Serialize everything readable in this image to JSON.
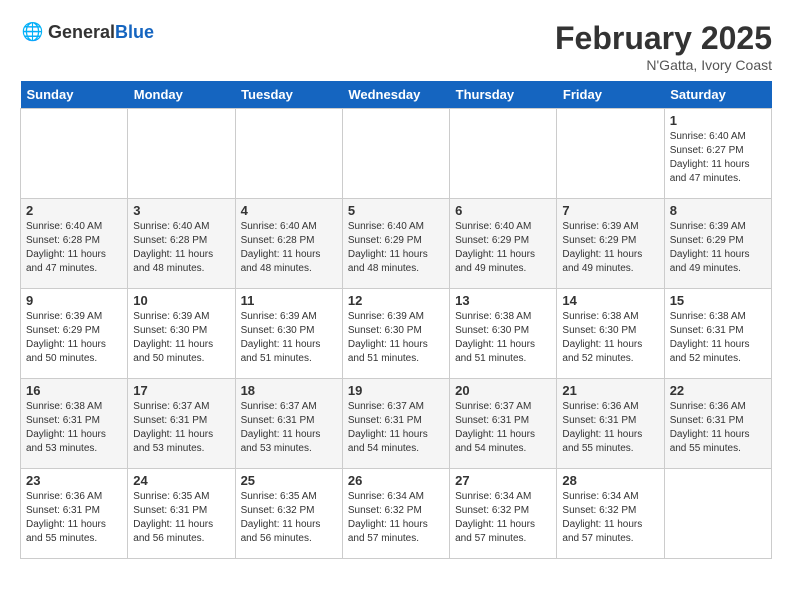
{
  "logo": {
    "text_general": "General",
    "text_blue": "Blue"
  },
  "title": "February 2025",
  "subtitle": "N'Gatta, Ivory Coast",
  "days_of_week": [
    "Sunday",
    "Monday",
    "Tuesday",
    "Wednesday",
    "Thursday",
    "Friday",
    "Saturday"
  ],
  "weeks": [
    [
      {
        "day": "",
        "info": ""
      },
      {
        "day": "",
        "info": ""
      },
      {
        "day": "",
        "info": ""
      },
      {
        "day": "",
        "info": ""
      },
      {
        "day": "",
        "info": ""
      },
      {
        "day": "",
        "info": ""
      },
      {
        "day": "1",
        "info": "Sunrise: 6:40 AM\nSunset: 6:27 PM\nDaylight: 11 hours and 47 minutes."
      }
    ],
    [
      {
        "day": "2",
        "info": "Sunrise: 6:40 AM\nSunset: 6:28 PM\nDaylight: 11 hours and 47 minutes."
      },
      {
        "day": "3",
        "info": "Sunrise: 6:40 AM\nSunset: 6:28 PM\nDaylight: 11 hours and 48 minutes."
      },
      {
        "day": "4",
        "info": "Sunrise: 6:40 AM\nSunset: 6:28 PM\nDaylight: 11 hours and 48 minutes."
      },
      {
        "day": "5",
        "info": "Sunrise: 6:40 AM\nSunset: 6:29 PM\nDaylight: 11 hours and 48 minutes."
      },
      {
        "day": "6",
        "info": "Sunrise: 6:40 AM\nSunset: 6:29 PM\nDaylight: 11 hours and 49 minutes."
      },
      {
        "day": "7",
        "info": "Sunrise: 6:39 AM\nSunset: 6:29 PM\nDaylight: 11 hours and 49 minutes."
      },
      {
        "day": "8",
        "info": "Sunrise: 6:39 AM\nSunset: 6:29 PM\nDaylight: 11 hours and 49 minutes."
      }
    ],
    [
      {
        "day": "9",
        "info": "Sunrise: 6:39 AM\nSunset: 6:29 PM\nDaylight: 11 hours and 50 minutes."
      },
      {
        "day": "10",
        "info": "Sunrise: 6:39 AM\nSunset: 6:30 PM\nDaylight: 11 hours and 50 minutes."
      },
      {
        "day": "11",
        "info": "Sunrise: 6:39 AM\nSunset: 6:30 PM\nDaylight: 11 hours and 51 minutes."
      },
      {
        "day": "12",
        "info": "Sunrise: 6:39 AM\nSunset: 6:30 PM\nDaylight: 11 hours and 51 minutes."
      },
      {
        "day": "13",
        "info": "Sunrise: 6:38 AM\nSunset: 6:30 PM\nDaylight: 11 hours and 51 minutes."
      },
      {
        "day": "14",
        "info": "Sunrise: 6:38 AM\nSunset: 6:30 PM\nDaylight: 11 hours and 52 minutes."
      },
      {
        "day": "15",
        "info": "Sunrise: 6:38 AM\nSunset: 6:31 PM\nDaylight: 11 hours and 52 minutes."
      }
    ],
    [
      {
        "day": "16",
        "info": "Sunrise: 6:38 AM\nSunset: 6:31 PM\nDaylight: 11 hours and 53 minutes."
      },
      {
        "day": "17",
        "info": "Sunrise: 6:37 AM\nSunset: 6:31 PM\nDaylight: 11 hours and 53 minutes."
      },
      {
        "day": "18",
        "info": "Sunrise: 6:37 AM\nSunset: 6:31 PM\nDaylight: 11 hours and 53 minutes."
      },
      {
        "day": "19",
        "info": "Sunrise: 6:37 AM\nSunset: 6:31 PM\nDaylight: 11 hours and 54 minutes."
      },
      {
        "day": "20",
        "info": "Sunrise: 6:37 AM\nSunset: 6:31 PM\nDaylight: 11 hours and 54 minutes."
      },
      {
        "day": "21",
        "info": "Sunrise: 6:36 AM\nSunset: 6:31 PM\nDaylight: 11 hours and 55 minutes."
      },
      {
        "day": "22",
        "info": "Sunrise: 6:36 AM\nSunset: 6:31 PM\nDaylight: 11 hours and 55 minutes."
      }
    ],
    [
      {
        "day": "23",
        "info": "Sunrise: 6:36 AM\nSunset: 6:31 PM\nDaylight: 11 hours and 55 minutes."
      },
      {
        "day": "24",
        "info": "Sunrise: 6:35 AM\nSunset: 6:31 PM\nDaylight: 11 hours and 56 minutes."
      },
      {
        "day": "25",
        "info": "Sunrise: 6:35 AM\nSunset: 6:32 PM\nDaylight: 11 hours and 56 minutes."
      },
      {
        "day": "26",
        "info": "Sunrise: 6:34 AM\nSunset: 6:32 PM\nDaylight: 11 hours and 57 minutes."
      },
      {
        "day": "27",
        "info": "Sunrise: 6:34 AM\nSunset: 6:32 PM\nDaylight: 11 hours and 57 minutes."
      },
      {
        "day": "28",
        "info": "Sunrise: 6:34 AM\nSunset: 6:32 PM\nDaylight: 11 hours and 57 minutes."
      },
      {
        "day": "",
        "info": ""
      }
    ]
  ]
}
